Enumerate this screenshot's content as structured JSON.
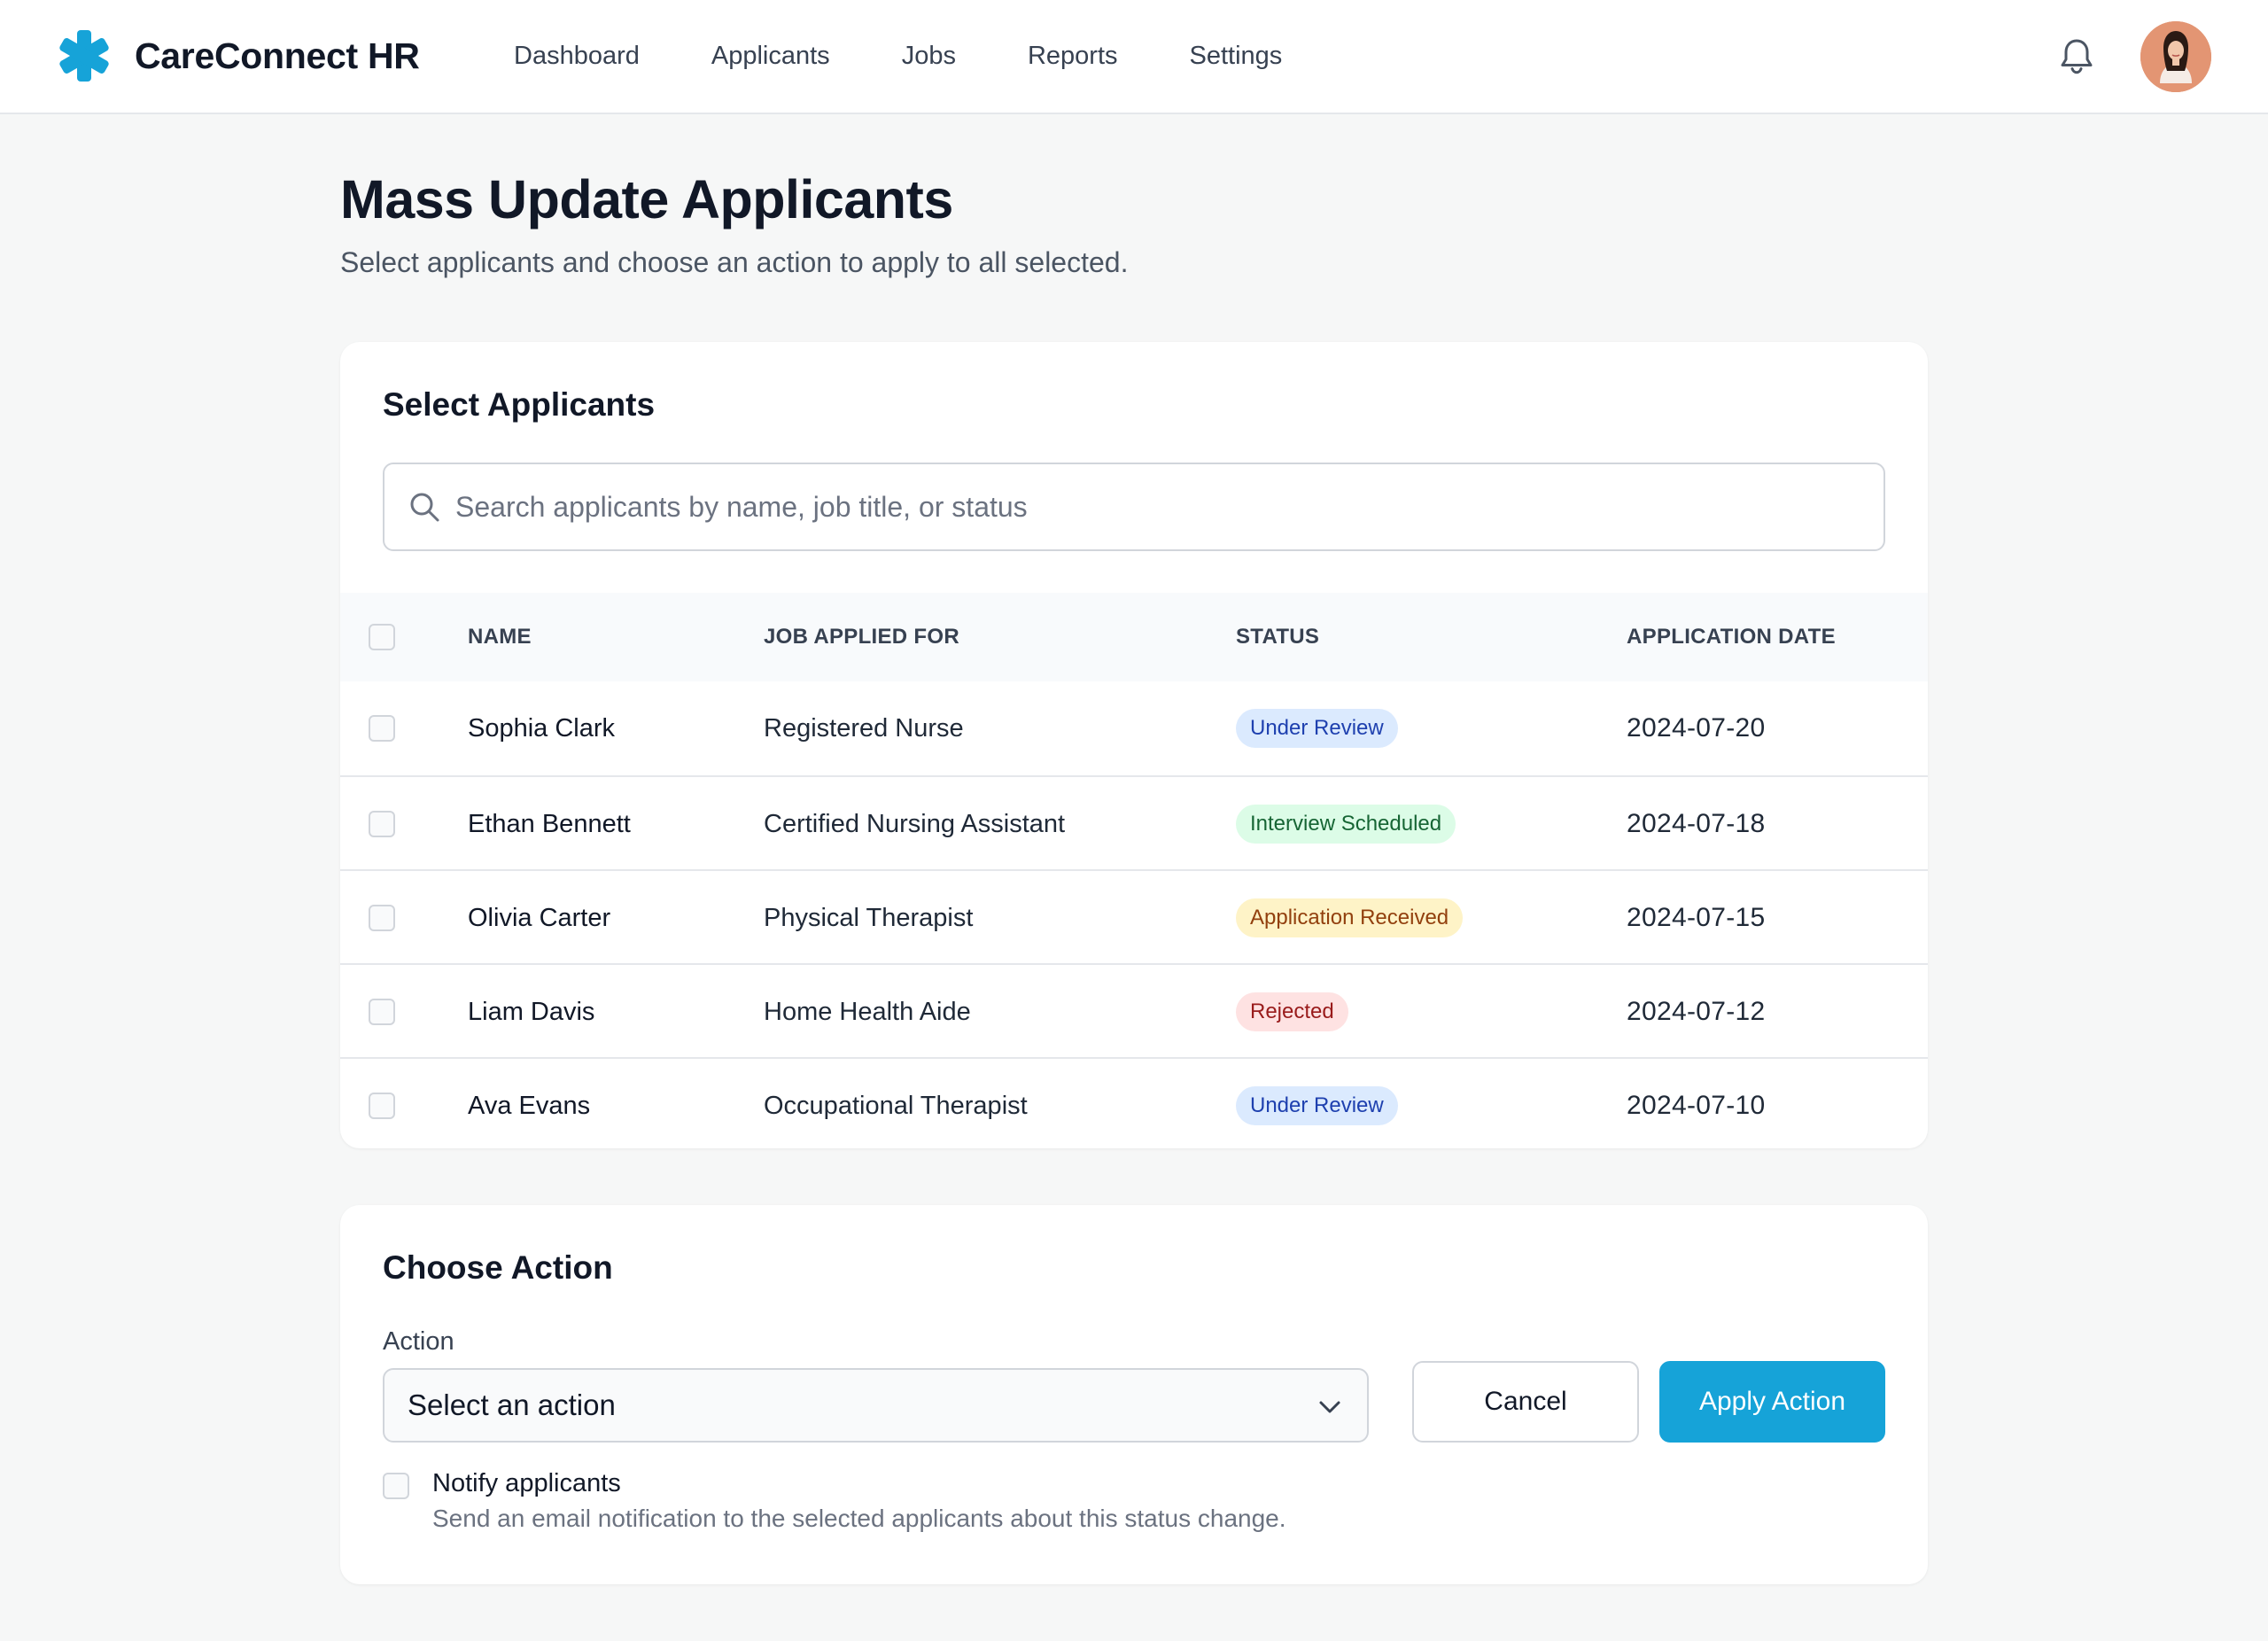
{
  "app": {
    "name": "CareConnect HR",
    "brand_color": "#16a3d8"
  },
  "nav": {
    "items": [
      "Dashboard",
      "Applicants",
      "Jobs",
      "Reports",
      "Settings"
    ]
  },
  "header_icons": {
    "notifications": "bell-icon",
    "profile": "user-avatar"
  },
  "page": {
    "title": "Mass Update Applicants",
    "subtitle": "Select applicants and choose an action to apply to all selected."
  },
  "applicants_card": {
    "title": "Select Applicants",
    "search_placeholder": "Search applicants by name, job title, or status",
    "columns": [
      "NAME",
      "JOB APPLIED FOR",
      "STATUS",
      "APPLICATION DATE"
    ],
    "rows": [
      {
        "name": "Sophia Clark",
        "job": "Registered Nurse",
        "status": "Under Review",
        "status_kind": "review",
        "date": "2024-07-20",
        "selected": false
      },
      {
        "name": "Ethan Bennett",
        "job": "Certified Nursing Assistant",
        "status": "Interview Scheduled",
        "status_kind": "interview",
        "date": "2024-07-18",
        "selected": false
      },
      {
        "name": "Olivia Carter",
        "job": "Physical Therapist",
        "status": "Application Received",
        "status_kind": "received",
        "date": "2024-07-15",
        "selected": false
      },
      {
        "name": "Liam Davis",
        "job": "Home Health Aide",
        "status": "Rejected",
        "status_kind": "rejected",
        "date": "2024-07-12",
        "selected": false
      },
      {
        "name": "Ava Evans",
        "job": "Occupational Therapist",
        "status": "Under Review",
        "status_kind": "review",
        "date": "2024-07-10",
        "selected": false
      }
    ],
    "status_colors": {
      "review": {
        "bg": "#dbeafe",
        "fg": "#1e40af"
      },
      "interview": {
        "bg": "#dcfce7",
        "fg": "#166534"
      },
      "received": {
        "bg": "#fef3c7",
        "fg": "#92400e"
      },
      "rejected": {
        "bg": "#fee2e2",
        "fg": "#991b1b"
      }
    }
  },
  "action_card": {
    "title": "Choose Action",
    "action_label": "Action",
    "action_value": "Select an action",
    "cancel_label": "Cancel",
    "apply_label": "Apply Action",
    "notify_label": "Notify applicants",
    "notify_help": "Send an email notification to the selected applicants about this status change.",
    "notify_checked": false
  }
}
